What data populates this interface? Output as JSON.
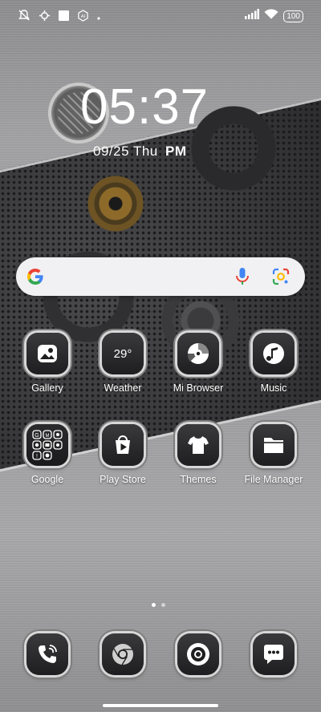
{
  "status_bar": {
    "left_icons": [
      "notifications-off-icon",
      "settings-sync-icon",
      "square-notification-icon",
      "ai-chip-icon",
      "dot-indicator-icon"
    ],
    "battery": "100",
    "right_icons": [
      "signal-icon",
      "wifi-icon"
    ]
  },
  "clock": {
    "time": "05:37",
    "date": "09/25 Thu",
    "ampm": "PM"
  },
  "search": {
    "icons": [
      "google-g-icon",
      "microphone-icon",
      "google-lens-icon"
    ]
  },
  "apps": [
    {
      "label": "Gallery",
      "icon": "gallery-icon"
    },
    {
      "label": "Weather",
      "icon": "weather-icon",
      "temp": "29°"
    },
    {
      "label": "Mi Browser",
      "icon": "browser-icon"
    },
    {
      "label": "Music",
      "icon": "music-icon"
    },
    {
      "label": "Google",
      "icon": "google-folder-icon"
    },
    {
      "label": "Play Store",
      "icon": "play-store-icon"
    },
    {
      "label": "Themes",
      "icon": "themes-icon"
    },
    {
      "label": "File Manager",
      "icon": "file-manager-icon"
    }
  ],
  "dock": [
    {
      "icon": "phone-icon"
    },
    {
      "icon": "chrome-icon"
    },
    {
      "icon": "camera-icon"
    },
    {
      "icon": "messages-icon"
    }
  ],
  "pager": {
    "pages": 2,
    "active": 1
  },
  "colors": {
    "accent": "#ffffff",
    "tile": "#2a2a2c",
    "band": "#2f2f31"
  }
}
